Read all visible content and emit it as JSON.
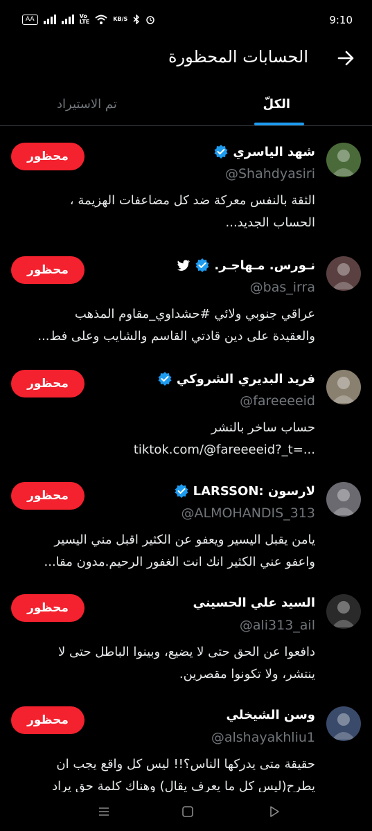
{
  "status_bar": {
    "time": "9:10",
    "lte_label": "Vo\nLTE",
    "speed_label": "KB/S",
    "battery_label": "AA"
  },
  "header": {
    "title": "الحسابات المحظورة",
    "back_icon": "arrow-right-icon"
  },
  "tabs": [
    {
      "label": "الكلّ",
      "active": true
    },
    {
      "label": "تم الاستيراد",
      "active": false
    }
  ],
  "accounts": [
    {
      "name": "شهد الياسري",
      "verified": true,
      "twitter_bird": false,
      "handle": "@Shahdyasiri",
      "bio": [
        "الثقة بالنفس معركة ضد كل مضاعفات الهزيمة ،",
        "الحساب الجديد..."
      ],
      "button": "محظور",
      "avatar_color": "#4a6a3a"
    },
    {
      "name": "نـورس. مـهاجـر.",
      "verified": true,
      "twitter_bird": true,
      "handle": "@bas_irra",
      "bio": [
        "عراقي جنوبي ولائي #حشداوي_مقاوم المذهب",
        "والعقيدة على دين قادتي القاسم والشايب وعلى فط..."
      ],
      "button": "محظور",
      "avatar_color": "#5a4040"
    },
    {
      "name": "فريد البديري الشروكي",
      "verified": true,
      "twitter_bird": false,
      "handle": "@fareeeeid",
      "bio": [
        "حساب ساخر بالنشر",
        "tiktok.com/@fareeeeid?_t=..."
      ],
      "button": "محظور",
      "avatar_color": "#8a8070"
    },
    {
      "name": "لارسون :LARSSON",
      "verified": true,
      "twitter_bird": false,
      "handle": "@ALMOHANDIS_313",
      "bio": [
        "يامن يقبل اليسير ويعفو عن الكثير اقبل مني اليسير",
        "واعفو عني الكثير انك انت الغفور الرحيم.مدون مقا..."
      ],
      "button": "محظور",
      "avatar_color": "#6a6a70"
    },
    {
      "name": "السيد علي الحسيني",
      "verified": false,
      "twitter_bird": false,
      "handle": "@ali313_ail",
      "bio": [
        "دافعوا عن الحق حتى لا يضيع، وبينوا الباطل حتى لا",
        "ينتشر، ولا تكونوا مقصرين."
      ],
      "button": "محظور",
      "avatar_color": "#2a2a2a"
    },
    {
      "name": "وسن الشيخلي",
      "verified": false,
      "twitter_bird": false,
      "handle": "@alshayakhliu1",
      "bio": [
        "حقيقة متى يدركها الناس؟!! ليس كل واقع يجب ان",
        "يطرح(ليس كل ما يعرف يقال) وهناك كلمة حق يراد"
      ],
      "button": "محظور",
      "avatar_color": "#3a4a6a"
    }
  ],
  "nav_bar": {
    "icons": [
      "menu-icon",
      "home-square-icon",
      "back-triangle-icon"
    ]
  },
  "colors": {
    "accent": "#1d9bf0",
    "danger": "#f4212e",
    "muted": "#71767b",
    "background": "#000000"
  }
}
